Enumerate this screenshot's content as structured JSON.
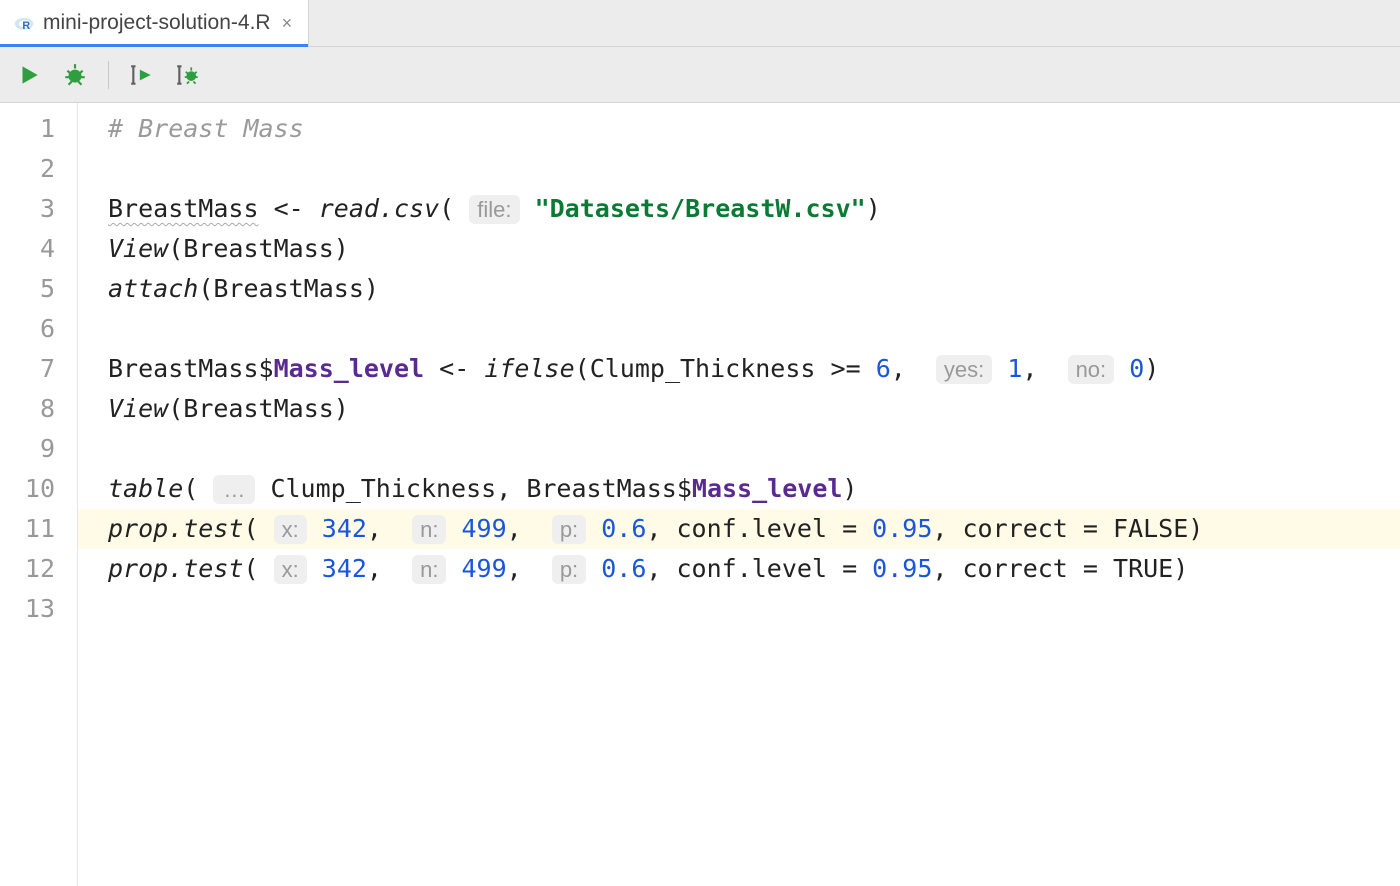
{
  "tab": {
    "filename": "mini-project-solution-4.R"
  },
  "icons": {
    "run": "run-icon",
    "debug": "bug-icon",
    "run_cursor": "run-cursor-icon",
    "debug_cursor": "debug-cursor-icon"
  },
  "gutter": [
    "1",
    "2",
    "3",
    "4",
    "5",
    "6",
    "7",
    "8",
    "9",
    "10",
    "11",
    "12",
    "13"
  ],
  "code": {
    "l1_comment": "# Breast Mass",
    "l3_var": "BreastMass",
    "l3_fn": "read.csv",
    "l3_hint": "file:",
    "l3_str": "\"Datasets/BreastW.csv\"",
    "l4_fn": "View",
    "l4_arg": "BreastMass",
    "l5_fn": "attach",
    "l5_arg": "BreastMass",
    "l7_lhs_obj": "BreastMass",
    "l7_lhs_field": "Mass_level",
    "l7_fn": "ifelse",
    "l7_cond_lhs": "Clump_Thickness",
    "l7_cond_op": ">=",
    "l7_cond_rhs": "6",
    "l7_yes_hint": "yes:",
    "l7_yes_val": "1",
    "l7_no_hint": "no:",
    "l7_no_val": "0",
    "l8_fn": "View",
    "l8_arg": "BreastMass",
    "l10_fn": "table",
    "l10_hint": "…",
    "l10_arg1": "Clump_Thickness",
    "l10_arg2_obj": "BreastMass",
    "l10_arg2_field": "Mass_level",
    "l11_fn": "prop.test",
    "l11_x_hint": "x:",
    "l11_x": "342",
    "l11_n_hint": "n:",
    "l11_n": "499",
    "l11_p_hint": "p:",
    "l11_p": "0.6",
    "l11_conf_name": "conf.level",
    "l11_conf_val": "0.95",
    "l11_corr_name": "correct",
    "l11_corr_val": "FALSE",
    "l12_fn": "prop.test",
    "l12_x_hint": "x:",
    "l12_x": "342",
    "l12_n_hint": "n:",
    "l12_n": "499",
    "l12_p_hint": "p:",
    "l12_p": "0.6",
    "l12_conf_name": "conf.level",
    "l12_conf_val": "0.95",
    "l12_corr_name": "correct",
    "l12_corr_val": "TRUE"
  }
}
